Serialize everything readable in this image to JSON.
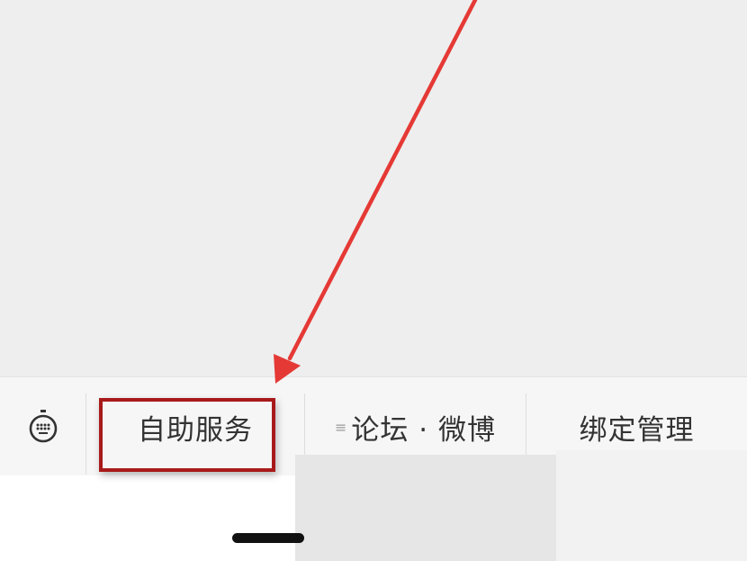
{
  "menu": {
    "keyboard_icon": "keyboard-icon",
    "items": [
      {
        "label": "自助服务"
      },
      {
        "label": "论坛 · 微博",
        "icon_glyph": "≡"
      },
      {
        "label": "绑定管理"
      }
    ]
  },
  "annotation": {
    "arrow_color": "#e53935",
    "highlight_color": "#a81a1a"
  }
}
